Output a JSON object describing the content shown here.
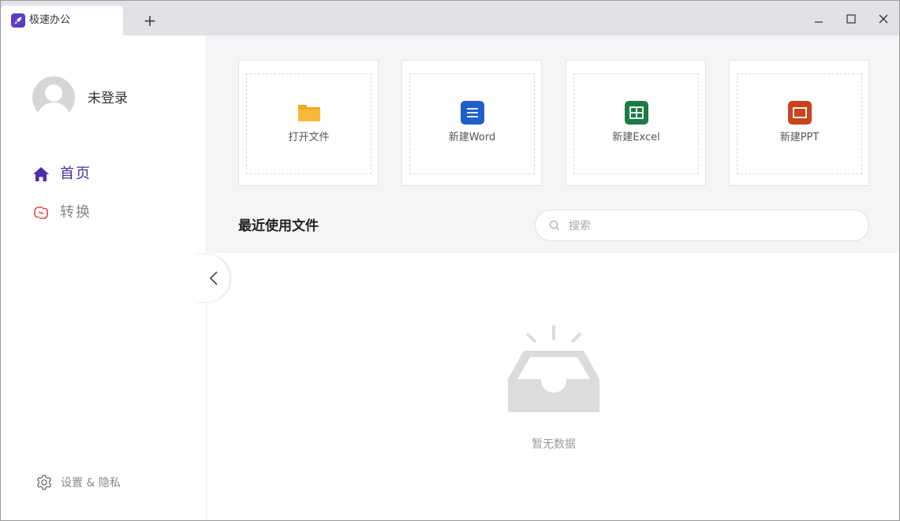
{
  "app": {
    "tab_title": "极速办公",
    "new_tab_symbol": "+"
  },
  "window_controls": [
    "minimize-icon",
    "maximize-icon",
    "close-icon"
  ],
  "sidebar": {
    "username": "未登录",
    "nav": [
      {
        "label": "首页",
        "icon": "home-icon",
        "active": true
      },
      {
        "label": "转换",
        "icon": "convert-icon",
        "active": false
      }
    ],
    "settings_label": "设置 & 隐私"
  },
  "actions": [
    {
      "label": "打开文件",
      "icon": "folder-icon",
      "color": "#f5a623"
    },
    {
      "label": "新建Word",
      "icon": "word-icon",
      "color": "#1f5fc7"
    },
    {
      "label": "新建Excel",
      "icon": "excel-icon",
      "color": "#1e7a45"
    },
    {
      "label": "新建PPT",
      "icon": "ppt-icon",
      "color": "#c8431e"
    }
  ],
  "recent": {
    "title": "最近使用文件",
    "search_placeholder": "搜索",
    "search_value": "",
    "empty_text": "暂无数据"
  },
  "colors": {
    "accent": "#4a2fa8",
    "titlebar": "#e2e2e6",
    "panel": "#f5f5f7"
  }
}
